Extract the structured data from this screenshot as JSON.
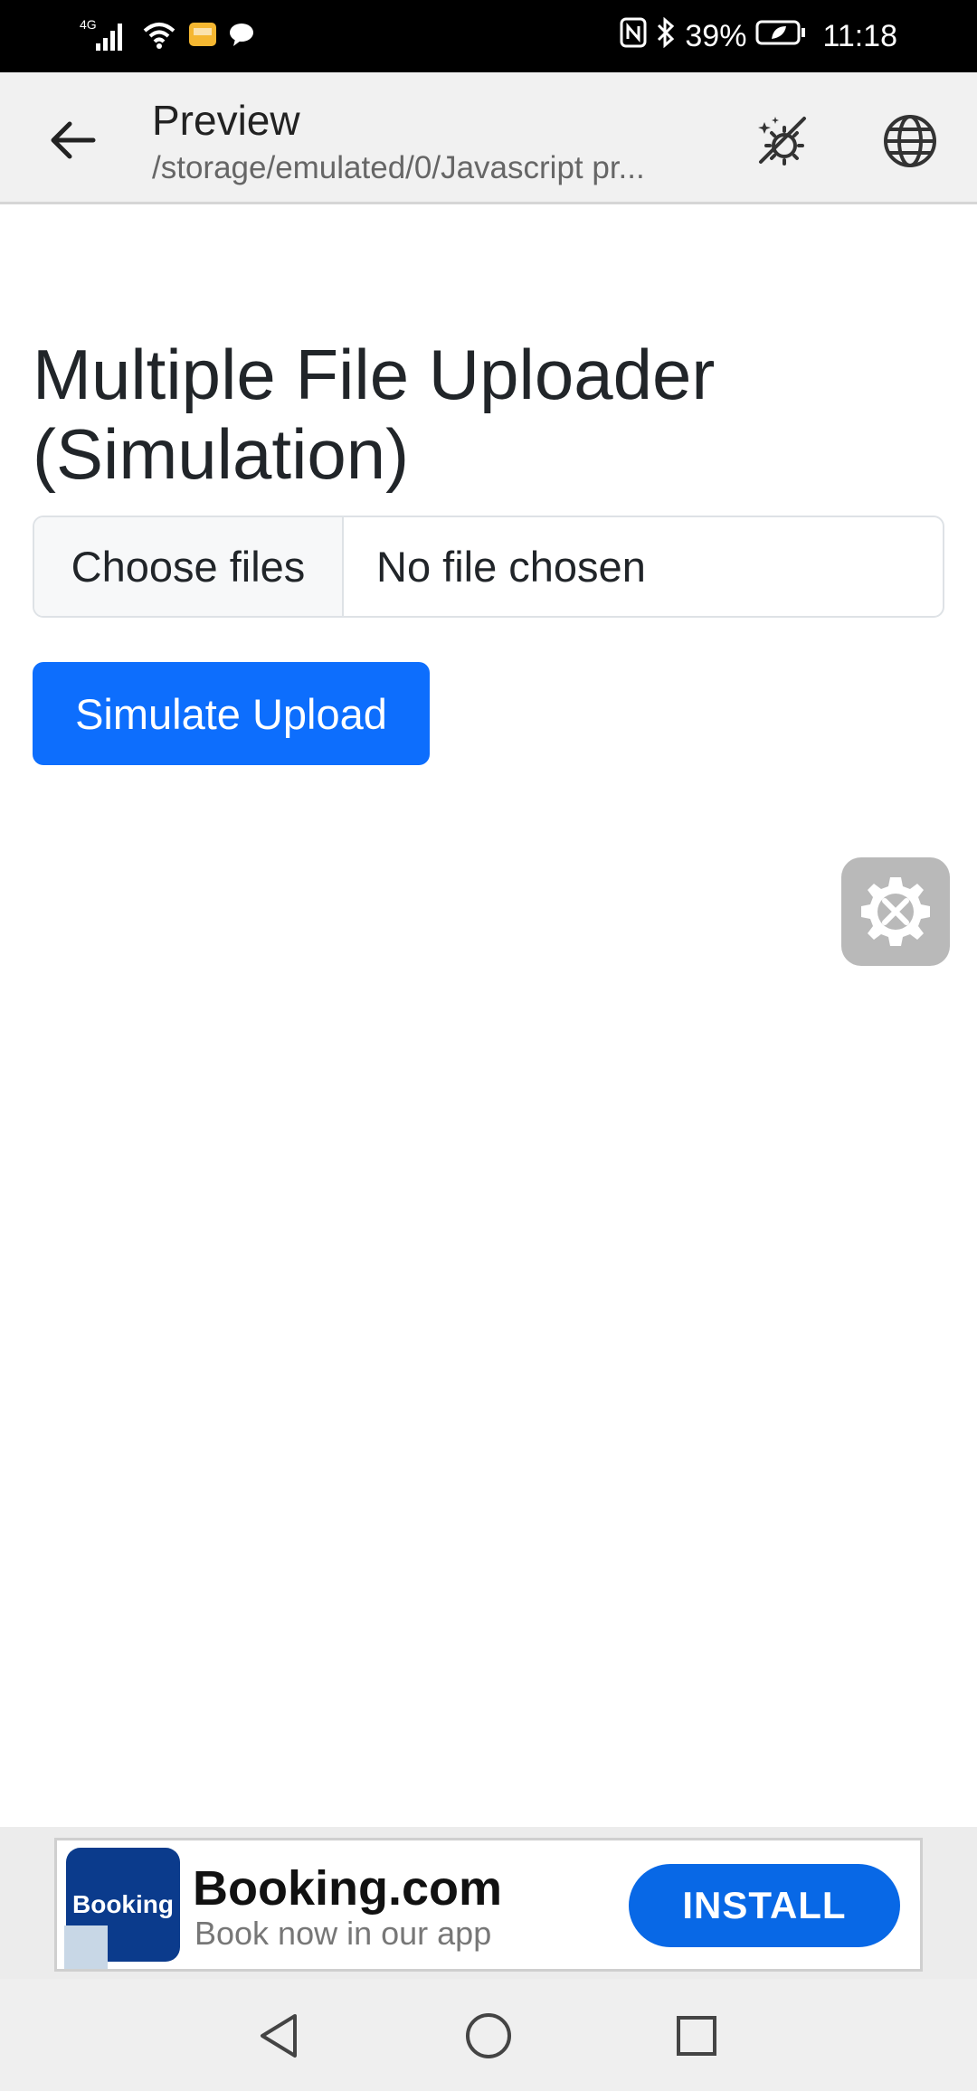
{
  "status_bar": {
    "network": "4G",
    "battery": "39%",
    "time": "11:18"
  },
  "app_bar": {
    "title": "Preview",
    "subtitle": "/storage/emulated/0/Javascript pr..."
  },
  "content": {
    "heading": "Multiple File Uploader (Simulation)",
    "file_input": {
      "button_label": "Choose files",
      "status": "No file chosen"
    },
    "upload_button": "Simulate Upload"
  },
  "ad": {
    "logo_text": "Booking",
    "title": "Booking.com",
    "subtitle": "Book now in our app",
    "install_label": "INSTALL"
  },
  "colors": {
    "primary": "#0d6efd",
    "ad_button": "#0868e6",
    "ad_logo": "#0b3b8c"
  }
}
